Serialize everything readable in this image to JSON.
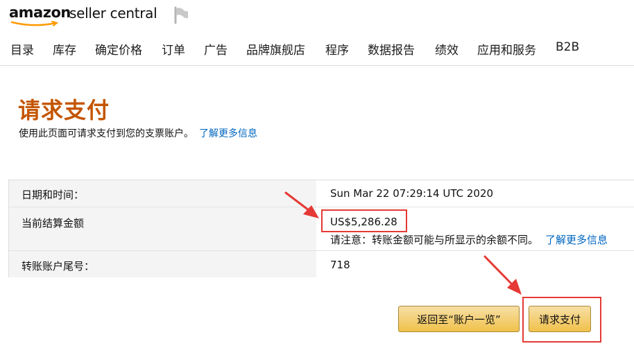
{
  "header": {
    "logo_amazon": "amazon",
    "logo_seller_central": "seller central",
    "flag_icon": "flag-icon"
  },
  "nav": {
    "items": [
      "目录",
      "库存",
      "确定价格",
      "订单",
      "广告",
      "品牌旗舰店",
      "程序",
      "数据报告",
      "绩效",
      "应用和服务",
      "B2B"
    ]
  },
  "page": {
    "title": "请求支付",
    "subtitle": "使用此页面可请求支付到您的支票账户。",
    "learn_more": "了解更多信息"
  },
  "details": {
    "date_label": "日期和时间：",
    "date_value": "Sun Mar 22 07:29:14 UTC 2020",
    "balance_label": "当前结算金额",
    "balance_value": "US$5,286.28",
    "note": "请注意：转账金额可能与所显示的余额不同。",
    "note_link": "了解更多信息",
    "account_label": "转账账户尾号：",
    "account_value": "718"
  },
  "buttons": {
    "back": "返回至“账户一览”",
    "request": "请求支付"
  },
  "colors": {
    "title": "#c45500",
    "link": "#0066c0",
    "highlight": "#e53935",
    "button": "#f0c14b"
  }
}
